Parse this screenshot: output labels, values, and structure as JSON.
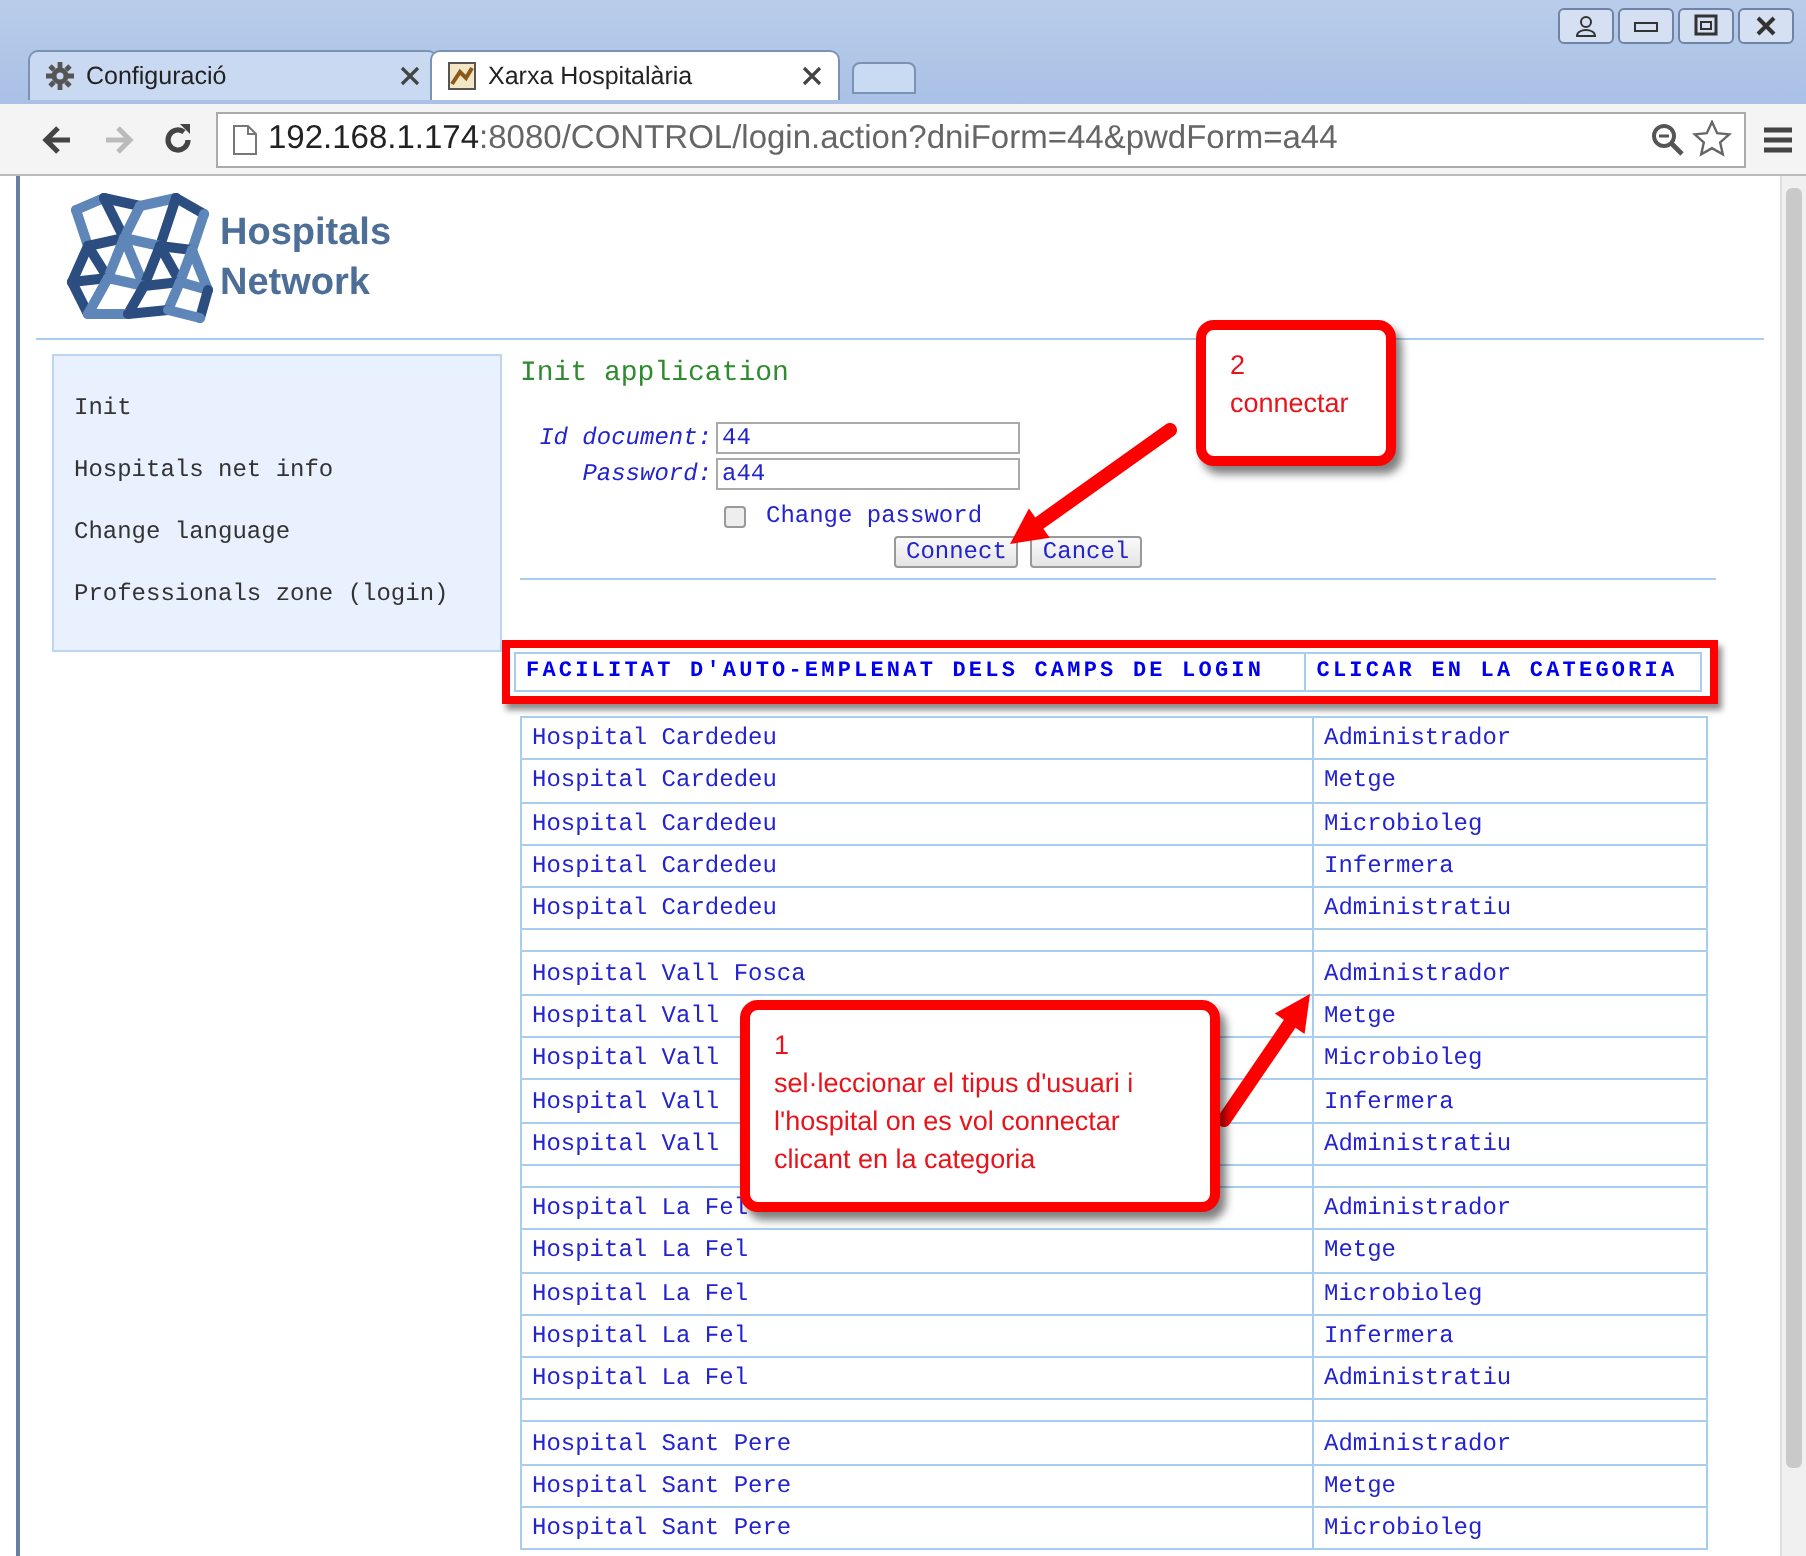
{
  "window": {
    "controls": [
      {
        "kind": "user"
      },
      {
        "kind": "minimize"
      },
      {
        "kind": "maximize"
      },
      {
        "kind": "close"
      }
    ]
  },
  "tabs": [
    {
      "label": "Configuració",
      "kind": "settings",
      "selected": false
    },
    {
      "label": "Xarxa Hospitalària",
      "kind": "site",
      "selected": true
    }
  ],
  "toolbar": {
    "nav_buttons": [
      {
        "kind": "back",
        "disabled": false
      },
      {
        "kind": "forward",
        "disabled": true
      },
      {
        "kind": "reload",
        "disabled": false
      }
    ],
    "address": {
      "host": "192.168.1.174",
      "rest": ":8080/CONTROL/login.action?dniForm=44&pwdForm=a44"
    }
  },
  "logo": {
    "line1": "Hospitals",
    "line2": "Network"
  },
  "sidebar": {
    "items": [
      "Init",
      "Hospitals net info",
      "Change language",
      "Professionals zone (login)"
    ]
  },
  "form": {
    "title": "Init application",
    "fields": [
      {
        "label": "Id document:",
        "value": "44"
      },
      {
        "label": "Password:",
        "value": "a44"
      }
    ],
    "checkbox": {
      "label": "Change password",
      "checked": false
    },
    "buttons": [
      "Connect",
      "Cancel"
    ]
  },
  "table": {
    "columns": [
      "FACILITAT D'AUTO-EMPLENAT DELS CAMPS DE LOGIN",
      "CLICAR EN LA CATEGORIA"
    ],
    "groups": [
      {
        "rows": [
          {
            "hospital": "Hospital Cardedeu",
            "category": "Administrador"
          },
          {
            "hospital": "Hospital Cardedeu",
            "category": "Metge"
          },
          {
            "hospital": "Hospital Cardedeu",
            "category": "Microbioleg"
          },
          {
            "hospital": "Hospital Cardedeu",
            "category": "Infermera"
          },
          {
            "hospital": "Hospital Cardedeu",
            "category": "Administratiu"
          }
        ]
      },
      {
        "rows": [
          {
            "hospital": "Hospital Vall Fosca",
            "category": "Administrador"
          },
          {
            "hospital": "Hospital Vall",
            "category": "Metge"
          },
          {
            "hospital": "Hospital Vall",
            "category": "Microbioleg"
          },
          {
            "hospital": "Hospital Vall",
            "category": "Infermera"
          },
          {
            "hospital": "Hospital Vall",
            "category": "Administratiu"
          }
        ]
      },
      {
        "rows": [
          {
            "hospital": "Hospital La Fel",
            "category": "Administrador"
          },
          {
            "hospital": "Hospital La Fel",
            "category": "Metge"
          },
          {
            "hospital": "Hospital La Fel",
            "category": "Microbioleg"
          },
          {
            "hospital": "Hospital La Fel",
            "category": "Infermera"
          },
          {
            "hospital": "Hospital La Fel",
            "category": "Administratiu"
          }
        ]
      },
      {
        "rows": [
          {
            "hospital": "Hospital Sant Pere",
            "category": "Administrador"
          },
          {
            "hospital": "Hospital Sant Pere",
            "category": "Metge"
          },
          {
            "hospital": "Hospital Sant Pere",
            "category": "Microbioleg"
          }
        ]
      }
    ]
  },
  "annotations": [
    {
      "number": "2",
      "text": "connectar"
    },
    {
      "number": "1",
      "text": "sel·leccionar el tipus d'usuari i l'hospital on es vol connectar clicant en la categoria"
    }
  ]
}
